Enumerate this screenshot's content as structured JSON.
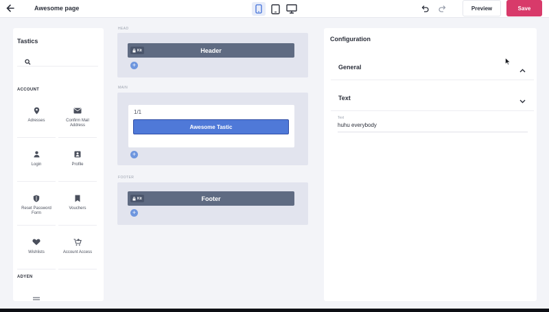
{
  "header": {
    "page_title": "Awesome page",
    "preview_label": "Preview",
    "save_label": "Save",
    "devices": [
      "mobile",
      "tablet",
      "desktop"
    ],
    "active_device": "mobile"
  },
  "sidebar": {
    "title": "Tastics",
    "search_placeholder": "",
    "sections": [
      {
        "label": "ACCOUNT",
        "items": [
          {
            "label": "Adresses",
            "icon": "location-pin-icon"
          },
          {
            "label": "Confirm Mail Address",
            "icon": "mail-icon"
          },
          {
            "label": "Login",
            "icon": "user-icon"
          },
          {
            "label": "Profile",
            "icon": "profile-card-icon"
          },
          {
            "label": "Reset Password Form",
            "icon": "shield-icon"
          },
          {
            "label": "Vouchers",
            "icon": "bookmark-icon"
          },
          {
            "label": "Wishlists",
            "icon": "heart-icon"
          },
          {
            "label": "Account Access",
            "icon": "cart-add-icon"
          }
        ]
      },
      {
        "label": "ADYEN",
        "items": [
          {
            "label": "",
            "icon": "list-icon"
          }
        ]
      }
    ]
  },
  "canvas": {
    "head": {
      "label": "HEAD",
      "kit": "Kit",
      "bar": "Header"
    },
    "main": {
      "label": "MAIN",
      "ratio": "1/1",
      "tastic": "Awesome Tastic"
    },
    "footer": {
      "label": "FOOTER",
      "kit": "Kit",
      "bar": "Footer"
    }
  },
  "config": {
    "title": "Configuration",
    "sections": [
      {
        "label": "General",
        "expanded": true
      },
      {
        "label": "Text",
        "expanded": true
      }
    ],
    "field": {
      "label": "Text",
      "value": "huhu everybody"
    }
  },
  "colors": {
    "save": "#d83a6a",
    "tastic": "#4f79d8",
    "bar": "#5f6b82",
    "zone": "#e2e4ee"
  }
}
